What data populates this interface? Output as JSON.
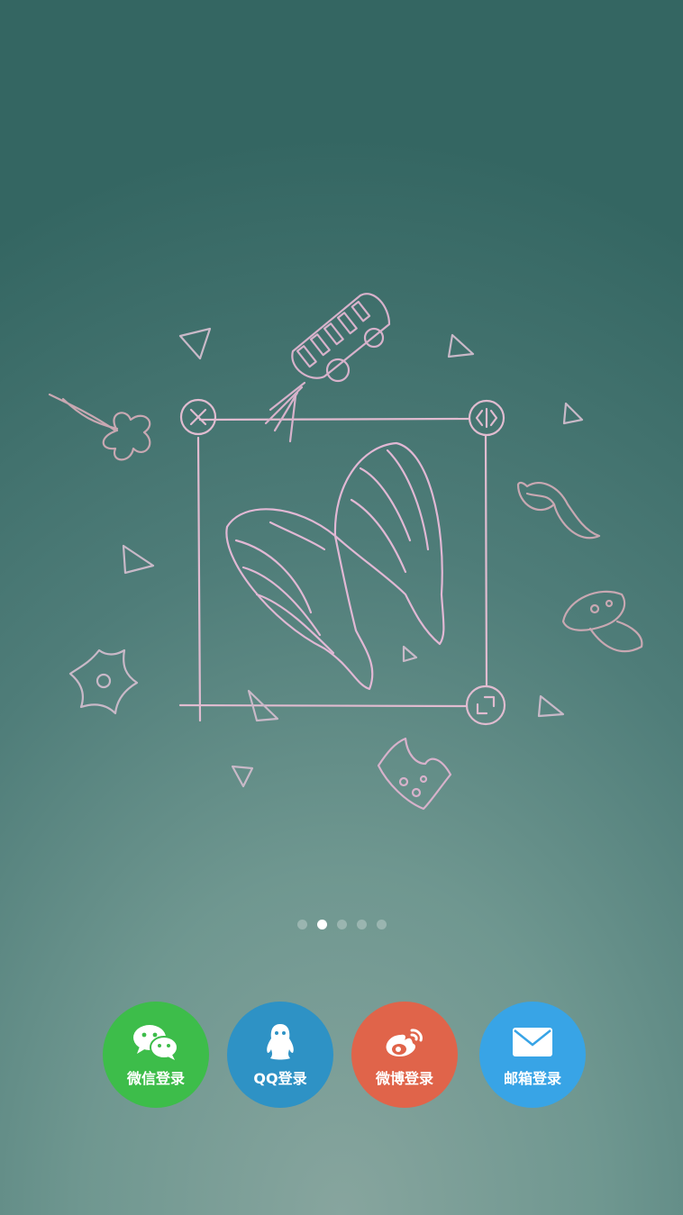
{
  "carousel": {
    "page_count": 5,
    "active_index": 1
  },
  "login": {
    "wechat": {
      "label": "微信登录",
      "icon": "wechat-icon",
      "color": "#3dbd4a"
    },
    "qq": {
      "label": "QQ登录",
      "icon": "qq-penguin-icon",
      "color": "#2e92c5"
    },
    "weibo": {
      "label": "微博登录",
      "icon": "weibo-icon",
      "color": "#e0644a"
    },
    "email": {
      "label": "邮箱登录",
      "icon": "envelope-icon",
      "color": "#38a4e6"
    }
  },
  "illustration": {
    "icons": [
      "crop-frame-icon",
      "close-icon",
      "flip-icon",
      "resize-icon",
      "angel-wings-icon",
      "bus-icon",
      "clover-icon",
      "moustache-icon",
      "mushroom-icon",
      "flower-icon",
      "crown-icon",
      "triangle-icon"
    ]
  }
}
